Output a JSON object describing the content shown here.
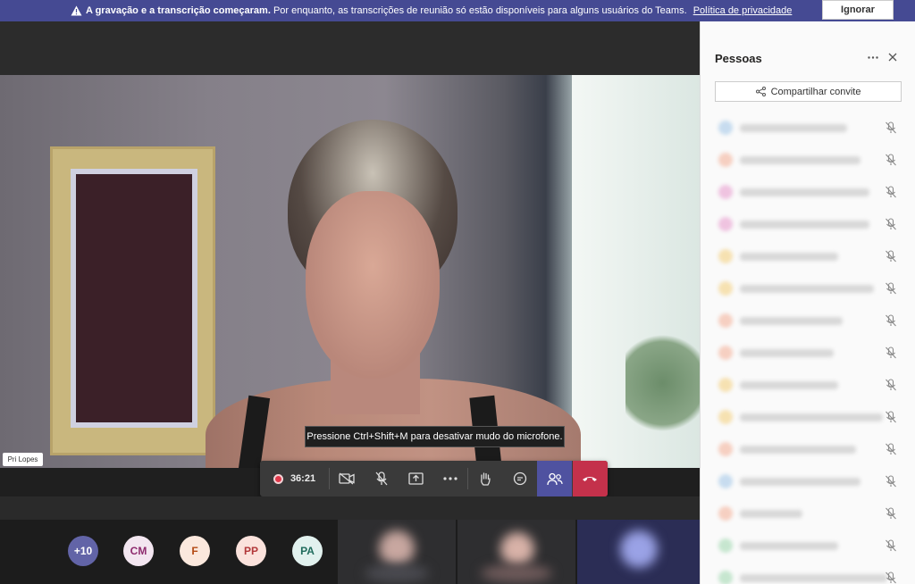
{
  "banner": {
    "bold_text": "A gravação e a transcrição começaram.",
    "text": "Por enquanto, as transcrições de reunião só estão disponíveis para alguns usuários do Teams.",
    "link": "Política de privacidade",
    "ignore_label": "Ignorar"
  },
  "stage": {
    "participant_name": "Pri Lopes",
    "tooltip": "Pressione Ctrl+Shift+M para desativar mudo do microfone."
  },
  "controls": {
    "timer": "36:21",
    "icons": [
      "camera-off-icon",
      "mic-off-icon",
      "share-screen-icon",
      "more-icon",
      "raise-hand-icon",
      "chat-icon",
      "people-icon",
      "hangup-icon"
    ],
    "colors": {
      "people_active": "#4f52a0",
      "hangup": "#c4314b",
      "record": "#e0374a"
    }
  },
  "gallery": {
    "avatars": [
      {
        "initials": "+10",
        "bg": "#6264a7",
        "fg": "#ffffff"
      },
      {
        "initials": "CM",
        "bg": "#f3e6f0",
        "fg": "#8e2b6e"
      },
      {
        "initials": "F",
        "bg": "#fbe8dd",
        "fg": "#b34a14"
      },
      {
        "initials": "PP",
        "bg": "#fbe2dc",
        "fg": "#b2383a"
      },
      {
        "initials": "PA",
        "bg": "#e1f1ee",
        "fg": "#1f6b5c"
      }
    ]
  },
  "panel": {
    "title": "Pessoas",
    "share_label": "Compartilhar convite",
    "rows": [
      {
        "color": "#c7dcef",
        "w": 120
      },
      {
        "color": "#f6cfc1",
        "w": 135
      },
      {
        "color": "#efc3e0",
        "w": 145
      },
      {
        "color": "#efc3e0",
        "w": 145
      },
      {
        "color": "#f6e1b1",
        "w": 110
      },
      {
        "color": "#f6e1b1",
        "w": 150
      },
      {
        "color": "#f6cfc1",
        "w": 115
      },
      {
        "color": "#f6cfc1",
        "w": 105
      },
      {
        "color": "#f6e1b1",
        "w": 110
      },
      {
        "color": "#f6e1b1",
        "w": 160
      },
      {
        "color": "#f6cfc1",
        "w": 130
      },
      {
        "color": "#c7dcef",
        "w": 135
      },
      {
        "color": "#f6cfc1",
        "w": 70
      },
      {
        "color": "#c6e6cf",
        "w": 110
      },
      {
        "color": "#c6e6cf",
        "w": 165
      }
    ]
  }
}
